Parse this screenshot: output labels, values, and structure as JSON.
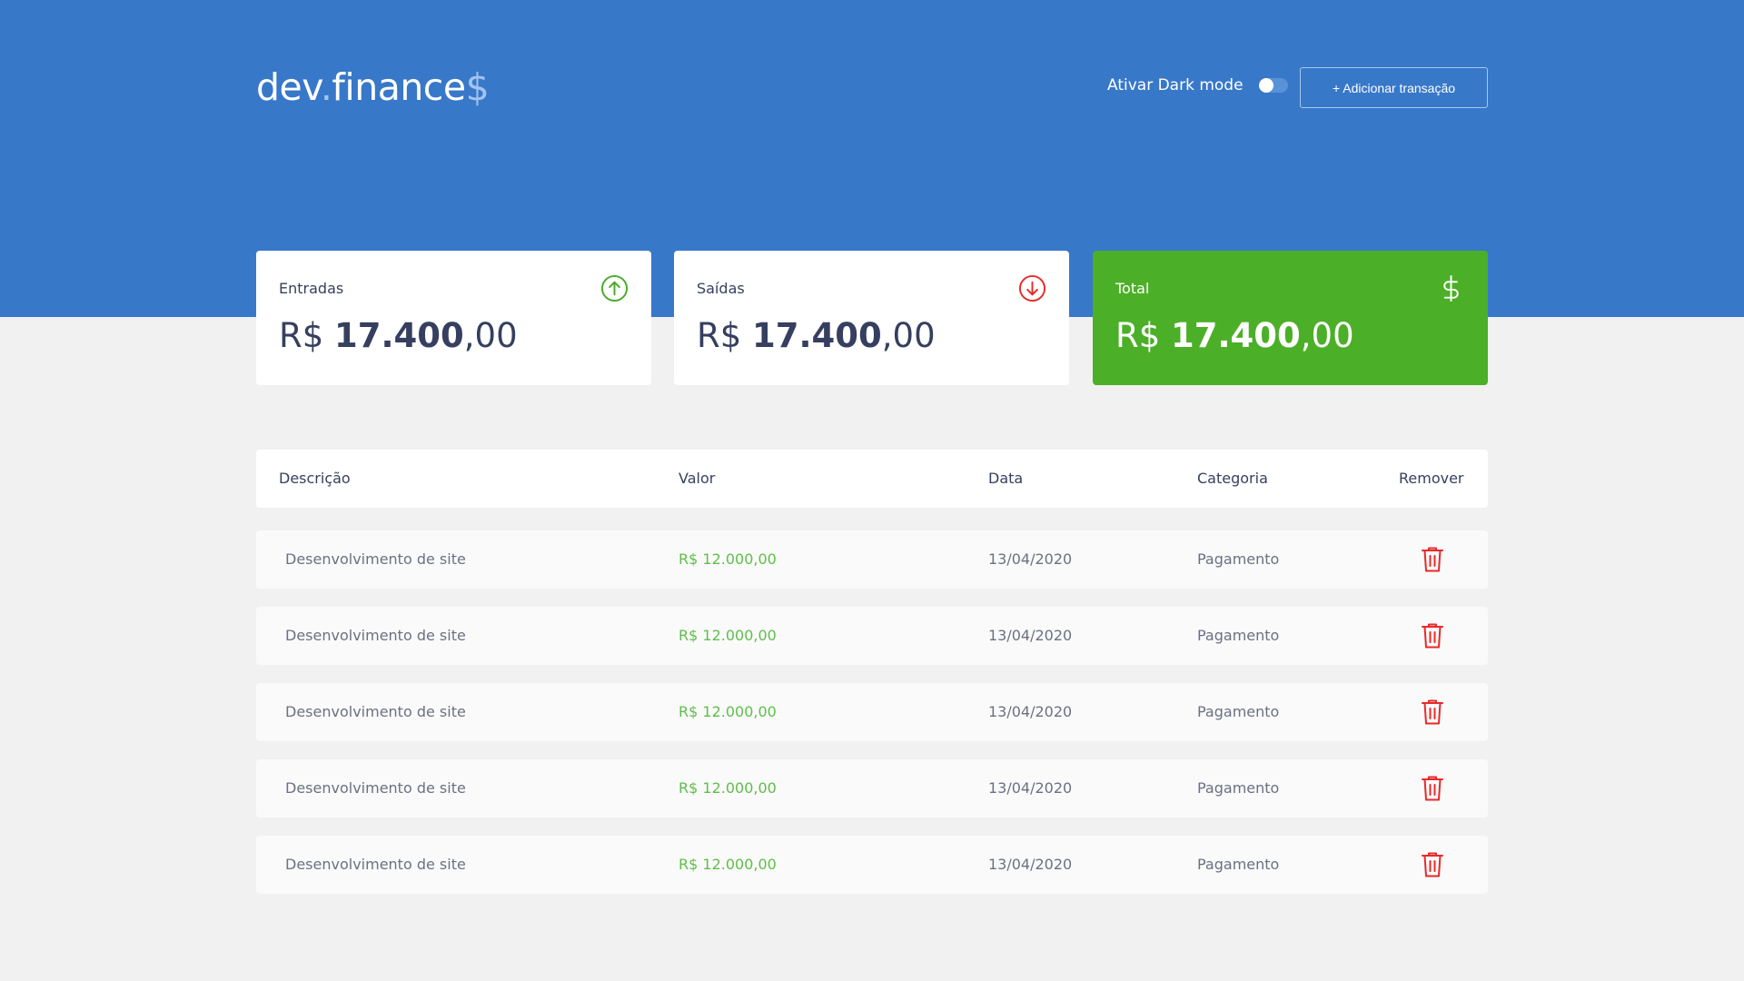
{
  "header": {
    "logo_main": "dev",
    "logo_dot": ".",
    "logo_rest": "finance",
    "logo_dollar": "$",
    "dark_mode_label": "Ativar Dark mode",
    "dark_mode_on": false,
    "add_button_label": "+ Adicionar transação"
  },
  "cards": {
    "income": {
      "title": "Entradas",
      "currency": "R$ ",
      "amount_int": "17.400",
      "amount_dec": ",00",
      "icon": "arrow-up-circle-icon"
    },
    "expense": {
      "title": "Saídas",
      "currency": "R$ ",
      "amount_int": "17.400",
      "amount_dec": ",00",
      "icon": "arrow-down-circle-icon"
    },
    "total": {
      "title": "Total",
      "currency": "R$ ",
      "amount_int": "17.400",
      "amount_dec": ",00",
      "icon": "dollar-icon"
    }
  },
  "table": {
    "headers": [
      "Descrição",
      "Valor",
      "Data",
      "Categoria",
      "Remover"
    ],
    "rows": [
      {
        "description": "Desenvolvimento de site",
        "value": "R$ 12.000,00",
        "date": "13/04/2020",
        "category": "Pagamento"
      },
      {
        "description": "Desenvolvimento de site",
        "value": "R$ 12.000,00",
        "date": "13/04/2020",
        "category": "Pagamento"
      },
      {
        "description": "Desenvolvimento de site",
        "value": "R$ 12.000,00",
        "date": "13/04/2020",
        "category": "Pagamento"
      },
      {
        "description": "Desenvolvimento de site",
        "value": "R$ 12.000,00",
        "date": "13/04/2020",
        "category": "Pagamento"
      },
      {
        "description": "Desenvolvimento de site",
        "value": "R$ 12.000,00",
        "date": "13/04/2020",
        "category": "Pagamento"
      }
    ]
  },
  "colors": {
    "header_bg": "#3878c9",
    "income": "#49aa26",
    "expense": "#e92929",
    "total_card": "#4caf28",
    "text": "#363f5f"
  }
}
